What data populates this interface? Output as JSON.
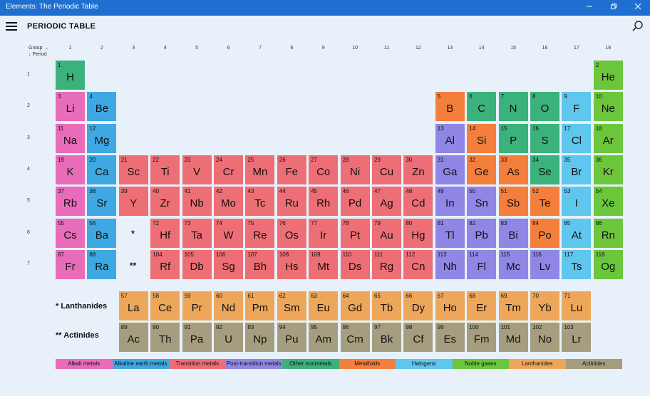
{
  "window": {
    "title": "Elements: The Periodic Table",
    "minimize_icon": "minimize-icon",
    "maximize_icon": "maximize-icon",
    "close_icon": "close-icon"
  },
  "header": {
    "title": "PERIODIC TABLE",
    "menu_icon": "hamburger-menu-icon",
    "search_icon": "search-icon"
  },
  "table": {
    "group_label": "Group →",
    "period_label": "↓ Period",
    "groups": [
      "1",
      "2",
      "3",
      "4",
      "5",
      "6",
      "7",
      "8",
      "9",
      "10",
      "11",
      "12",
      "13",
      "14",
      "15",
      "16",
      "17",
      "18"
    ],
    "periods": [
      "1",
      "2",
      "3",
      "4",
      "5",
      "6",
      "7"
    ],
    "lanthanide_marker": "*",
    "actinide_marker": "**",
    "lanthanides_label": "* Lanthanides",
    "actinides_label": "** Actinides",
    "colors": {
      "alkali": "#e86cb9",
      "alkaline": "#3ea8e2",
      "transition": "#ee6e75",
      "post": "#8f86e6",
      "nonmetal": "#3bb27c",
      "metalloid": "#f47f3c",
      "halogen": "#5fc6ee",
      "noble": "#6cc63c",
      "lanthanide": "#eea75a",
      "actinide": "#a59d7f"
    },
    "elements": [
      {
        "n": "1",
        "s": "H",
        "c": "nonmetal",
        "g": 1,
        "p": 1
      },
      {
        "n": "2",
        "s": "He",
        "c": "noble",
        "g": 18,
        "p": 1
      },
      {
        "n": "3",
        "s": "Li",
        "c": "alkali",
        "g": 1,
        "p": 2
      },
      {
        "n": "4",
        "s": "Be",
        "c": "alkaline",
        "g": 2,
        "p": 2
      },
      {
        "n": "5",
        "s": "B",
        "c": "metalloid",
        "g": 13,
        "p": 2
      },
      {
        "n": "6",
        "s": "C",
        "c": "nonmetal",
        "g": 14,
        "p": 2
      },
      {
        "n": "7",
        "s": "N",
        "c": "nonmetal",
        "g": 15,
        "p": 2
      },
      {
        "n": "8",
        "s": "O",
        "c": "nonmetal",
        "g": 16,
        "p": 2
      },
      {
        "n": "9",
        "s": "F",
        "c": "halogen",
        "g": 17,
        "p": 2
      },
      {
        "n": "10",
        "s": "Ne",
        "c": "noble",
        "g": 18,
        "p": 2
      },
      {
        "n": "11",
        "s": "Na",
        "c": "alkali",
        "g": 1,
        "p": 3
      },
      {
        "n": "12",
        "s": "Mg",
        "c": "alkaline",
        "g": 2,
        "p": 3
      },
      {
        "n": "13",
        "s": "Al",
        "c": "post",
        "g": 13,
        "p": 3
      },
      {
        "n": "14",
        "s": "Si",
        "c": "metalloid",
        "g": 14,
        "p": 3
      },
      {
        "n": "15",
        "s": "P",
        "c": "nonmetal",
        "g": 15,
        "p": 3
      },
      {
        "n": "16",
        "s": "S",
        "c": "nonmetal",
        "g": 16,
        "p": 3
      },
      {
        "n": "17",
        "s": "Cl",
        "c": "halogen",
        "g": 17,
        "p": 3
      },
      {
        "n": "18",
        "s": "Ar",
        "c": "noble",
        "g": 18,
        "p": 3
      },
      {
        "n": "19",
        "s": "K",
        "c": "alkali",
        "g": 1,
        "p": 4
      },
      {
        "n": "20",
        "s": "Ca",
        "c": "alkaline",
        "g": 2,
        "p": 4
      },
      {
        "n": "21",
        "s": "Sc",
        "c": "transition",
        "g": 3,
        "p": 4
      },
      {
        "n": "22",
        "s": "Ti",
        "c": "transition",
        "g": 4,
        "p": 4
      },
      {
        "n": "23",
        "s": "V",
        "c": "transition",
        "g": 5,
        "p": 4
      },
      {
        "n": "24",
        "s": "Cr",
        "c": "transition",
        "g": 6,
        "p": 4
      },
      {
        "n": "25",
        "s": "Mn",
        "c": "transition",
        "g": 7,
        "p": 4
      },
      {
        "n": "26",
        "s": "Fe",
        "c": "transition",
        "g": 8,
        "p": 4
      },
      {
        "n": "27",
        "s": "Co",
        "c": "transition",
        "g": 9,
        "p": 4
      },
      {
        "n": "28",
        "s": "Ni",
        "c": "transition",
        "g": 10,
        "p": 4
      },
      {
        "n": "29",
        "s": "Cu",
        "c": "transition",
        "g": 11,
        "p": 4
      },
      {
        "n": "30",
        "s": "Zn",
        "c": "transition",
        "g": 12,
        "p": 4
      },
      {
        "n": "31",
        "s": "Ga",
        "c": "post",
        "g": 13,
        "p": 4
      },
      {
        "n": "32",
        "s": "Ge",
        "c": "metalloid",
        "g": 14,
        "p": 4
      },
      {
        "n": "33",
        "s": "As",
        "c": "metalloid",
        "g": 15,
        "p": 4
      },
      {
        "n": "34",
        "s": "Se",
        "c": "nonmetal",
        "g": 16,
        "p": 4
      },
      {
        "n": "35",
        "s": "Br",
        "c": "halogen",
        "g": 17,
        "p": 4
      },
      {
        "n": "36",
        "s": "Kr",
        "c": "noble",
        "g": 18,
        "p": 4
      },
      {
        "n": "37",
        "s": "Rb",
        "c": "alkali",
        "g": 1,
        "p": 5
      },
      {
        "n": "38",
        "s": "Sr",
        "c": "alkaline",
        "g": 2,
        "p": 5
      },
      {
        "n": "39",
        "s": "Y",
        "c": "transition",
        "g": 3,
        "p": 5
      },
      {
        "n": "40",
        "s": "Zr",
        "c": "transition",
        "g": 4,
        "p": 5
      },
      {
        "n": "41",
        "s": "Nb",
        "c": "transition",
        "g": 5,
        "p": 5
      },
      {
        "n": "42",
        "s": "Mo",
        "c": "transition",
        "g": 6,
        "p": 5
      },
      {
        "n": "43",
        "s": "Tc",
        "c": "transition",
        "g": 7,
        "p": 5
      },
      {
        "n": "44",
        "s": "Ru",
        "c": "transition",
        "g": 8,
        "p": 5
      },
      {
        "n": "45",
        "s": "Rh",
        "c": "transition",
        "g": 9,
        "p": 5
      },
      {
        "n": "46",
        "s": "Pd",
        "c": "transition",
        "g": 10,
        "p": 5
      },
      {
        "n": "47",
        "s": "Ag",
        "c": "transition",
        "g": 11,
        "p": 5
      },
      {
        "n": "48",
        "s": "Cd",
        "c": "transition",
        "g": 12,
        "p": 5
      },
      {
        "n": "49",
        "s": "In",
        "c": "post",
        "g": 13,
        "p": 5
      },
      {
        "n": "50",
        "s": "Sn",
        "c": "post",
        "g": 14,
        "p": 5
      },
      {
        "n": "51",
        "s": "Sb",
        "c": "metalloid",
        "g": 15,
        "p": 5
      },
      {
        "n": "52",
        "s": "Te",
        "c": "metalloid",
        "g": 16,
        "p": 5
      },
      {
        "n": "53",
        "s": "I",
        "c": "halogen",
        "g": 17,
        "p": 5
      },
      {
        "n": "54",
        "s": "Xe",
        "c": "noble",
        "g": 18,
        "p": 5
      },
      {
        "n": "55",
        "s": "Cs",
        "c": "alkali",
        "g": 1,
        "p": 6
      },
      {
        "n": "56",
        "s": "Ba",
        "c": "alkaline",
        "g": 2,
        "p": 6
      },
      {
        "n": "72",
        "s": "Hf",
        "c": "transition",
        "g": 4,
        "p": 6
      },
      {
        "n": "73",
        "s": "Ta",
        "c": "transition",
        "g": 5,
        "p": 6
      },
      {
        "n": "74",
        "s": "W",
        "c": "transition",
        "g": 6,
        "p": 6
      },
      {
        "n": "75",
        "s": "Re",
        "c": "transition",
        "g": 7,
        "p": 6
      },
      {
        "n": "76",
        "s": "Os",
        "c": "transition",
        "g": 8,
        "p": 6
      },
      {
        "n": "77",
        "s": "Ir",
        "c": "transition",
        "g": 9,
        "p": 6
      },
      {
        "n": "78",
        "s": "Pt",
        "c": "transition",
        "g": 10,
        "p": 6
      },
      {
        "n": "79",
        "s": "Au",
        "c": "transition",
        "g": 11,
        "p": 6
      },
      {
        "n": "80",
        "s": "Hg",
        "c": "transition",
        "g": 12,
        "p": 6
      },
      {
        "n": "81",
        "s": "Tl",
        "c": "post",
        "g": 13,
        "p": 6
      },
      {
        "n": "82",
        "s": "Pb",
        "c": "post",
        "g": 14,
        "p": 6
      },
      {
        "n": "83",
        "s": "Bi",
        "c": "post",
        "g": 15,
        "p": 6
      },
      {
        "n": "84",
        "s": "Po",
        "c": "metalloid",
        "g": 16,
        "p": 6
      },
      {
        "n": "85",
        "s": "At",
        "c": "halogen",
        "g": 17,
        "p": 6
      },
      {
        "n": "86",
        "s": "Rn",
        "c": "noble",
        "g": 18,
        "p": 6
      },
      {
        "n": "87",
        "s": "Fr",
        "c": "alkali",
        "g": 1,
        "p": 7
      },
      {
        "n": "88",
        "s": "Ra",
        "c": "alkaline",
        "g": 2,
        "p": 7
      },
      {
        "n": "104",
        "s": "Rf",
        "c": "transition",
        "g": 4,
        "p": 7
      },
      {
        "n": "105",
        "s": "Db",
        "c": "transition",
        "g": 5,
        "p": 7
      },
      {
        "n": "106",
        "s": "Sg",
        "c": "transition",
        "g": 6,
        "p": 7
      },
      {
        "n": "107",
        "s": "Bh",
        "c": "transition",
        "g": 7,
        "p": 7
      },
      {
        "n": "108",
        "s": "Hs",
        "c": "transition",
        "g": 8,
        "p": 7
      },
      {
        "n": "109",
        "s": "Mt",
        "c": "transition",
        "g": 9,
        "p": 7
      },
      {
        "n": "110",
        "s": "Ds",
        "c": "transition",
        "g": 10,
        "p": 7
      },
      {
        "n": "111",
        "s": "Rg",
        "c": "transition",
        "g": 11,
        "p": 7
      },
      {
        "n": "112",
        "s": "Cn",
        "c": "transition",
        "g": 12,
        "p": 7
      },
      {
        "n": "113",
        "s": "Nh",
        "c": "post",
        "g": 13,
        "p": 7
      },
      {
        "n": "114",
        "s": "Fl",
        "c": "post",
        "g": 14,
        "p": 7
      },
      {
        "n": "115",
        "s": "Mc",
        "c": "post",
        "g": 15,
        "p": 7
      },
      {
        "n": "116",
        "s": "Lv",
        "c": "post",
        "g": 16,
        "p": 7
      },
      {
        "n": "117",
        "s": "Ts",
        "c": "halogen",
        "g": 17,
        "p": 7
      },
      {
        "n": "118",
        "s": "Og",
        "c": "noble",
        "g": 18,
        "p": 7
      }
    ],
    "lanthanides": [
      {
        "n": "57",
        "s": "La"
      },
      {
        "n": "58",
        "s": "Ce"
      },
      {
        "n": "59",
        "s": "Pr"
      },
      {
        "n": "60",
        "s": "Nd"
      },
      {
        "n": "61",
        "s": "Pm"
      },
      {
        "n": "62",
        "s": "Sm"
      },
      {
        "n": "63",
        "s": "Eu"
      },
      {
        "n": "64",
        "s": "Gd"
      },
      {
        "n": "65",
        "s": "Tb"
      },
      {
        "n": "66",
        "s": "Dy"
      },
      {
        "n": "67",
        "s": "Ho"
      },
      {
        "n": "68",
        "s": "Er"
      },
      {
        "n": "69",
        "s": "Tm"
      },
      {
        "n": "70",
        "s": "Yb"
      },
      {
        "n": "71",
        "s": "Lu"
      }
    ],
    "actinides": [
      {
        "n": "89",
        "s": "Ac"
      },
      {
        "n": "90",
        "s": "Th"
      },
      {
        "n": "91",
        "s": "Pa"
      },
      {
        "n": "92",
        "s": "U"
      },
      {
        "n": "93",
        "s": "Np"
      },
      {
        "n": "94",
        "s": "Pu"
      },
      {
        "n": "95",
        "s": "Am"
      },
      {
        "n": "96",
        "s": "Cm"
      },
      {
        "n": "97",
        "s": "Bk"
      },
      {
        "n": "98",
        "s": "Cf"
      },
      {
        "n": "99",
        "s": "Es"
      },
      {
        "n": "100",
        "s": "Fm"
      },
      {
        "n": "101",
        "s": "Md"
      },
      {
        "n": "102",
        "s": "No"
      },
      {
        "n": "103",
        "s": "Lr"
      }
    ]
  },
  "legend": [
    {
      "label": "Alkali metals",
      "color": "#e86cb9"
    },
    {
      "label": "Alkaline earth metals",
      "color": "#3ea8e2"
    },
    {
      "label": "Transition metals",
      "color": "#ee6e75"
    },
    {
      "label": "Post-transition metals",
      "color": "#8f86e6"
    },
    {
      "label": "Other nonmetals",
      "color": "#3bb27c"
    },
    {
      "label": "Metalloids",
      "color": "#f47f3c"
    },
    {
      "label": "Halogens",
      "color": "#5fc6ee"
    },
    {
      "label": "Noble gases",
      "color": "#6cc63c"
    },
    {
      "label": "Lanthanides",
      "color": "#eea75a"
    },
    {
      "label": "Actinides",
      "color": "#a59d7f"
    }
  ]
}
